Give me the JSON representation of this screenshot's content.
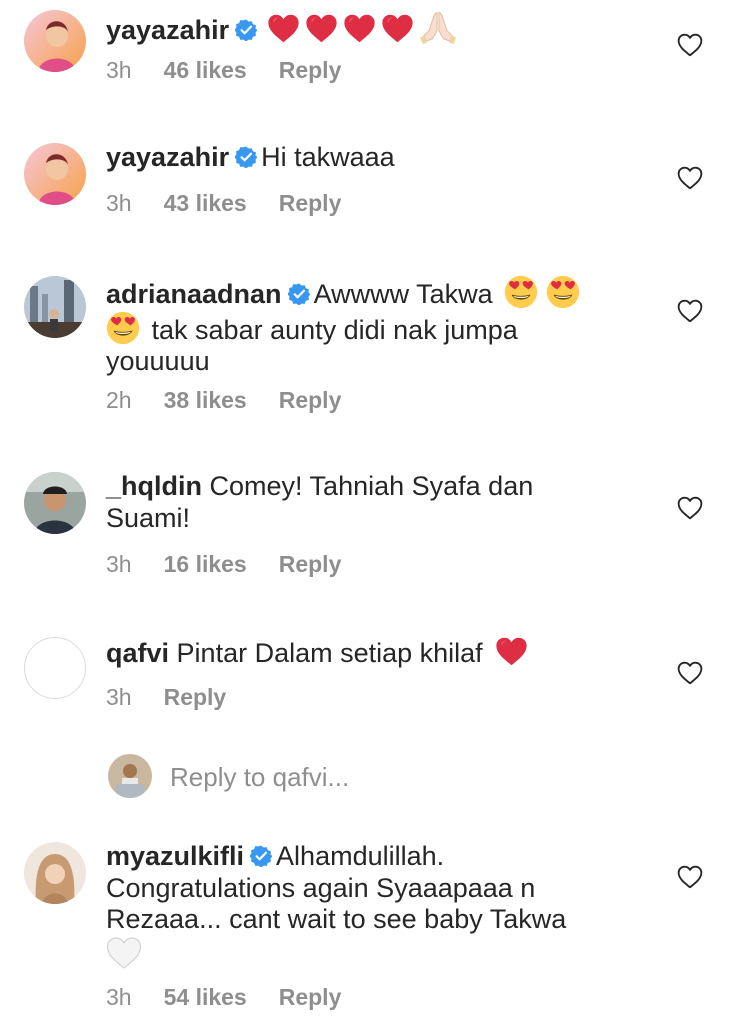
{
  "labels": {
    "reply": "Reply",
    "like_suffix": "likes"
  },
  "comments": [
    {
      "username": "yayazahir",
      "verified": true,
      "text": "",
      "time": "3h",
      "likes": "46 likes",
      "reply": "Reply"
    },
    {
      "username": "yayazahir",
      "verified": true,
      "text": "Hi takwaaa",
      "time": "3h",
      "likes": "43 likes",
      "reply": "Reply"
    },
    {
      "username": "adrianaadnan",
      "verified": true,
      "text_a": "Awwww Takwa",
      "text_b": "tak sabar aunty didi nak jumpa",
      "text_c": "youuuuu",
      "time": "2h",
      "likes": "38 likes",
      "reply": "Reply"
    },
    {
      "username": "_hqldin",
      "verified": false,
      "text": "Comey! Tahniah Syafa dan Suami!",
      "time": "3h",
      "likes": "16 likes",
      "reply": "Reply"
    },
    {
      "username": "qafvi",
      "verified": false,
      "text": "Pintar Dalam setiap khilaf",
      "time": "3h",
      "likes": "",
      "reply": "Reply"
    },
    {
      "username": "myazulkifli",
      "verified": true,
      "text": "Alhamdulillah. Congratulations again Syaaapaaa n Rezaaa... cant wait to see baby  Takwa",
      "time": "3h",
      "likes": "54 likes",
      "reply": "Reply"
    }
  ],
  "reply_input": {
    "placeholder": "Reply to qafvi..."
  },
  "icons": {
    "like": "heart-outline-icon",
    "verified": "verified-badge-icon",
    "red_heart": "red-heart-emoji",
    "white_heart": "white-heart-emoji",
    "heart_eyes": "heart-eyes-emoji",
    "pray": "folded-hands-emoji"
  },
  "colors": {
    "text": "#262626",
    "secondary": "#8e8e8e",
    "verified": "#3897f0",
    "heart": "#e0245e"
  }
}
